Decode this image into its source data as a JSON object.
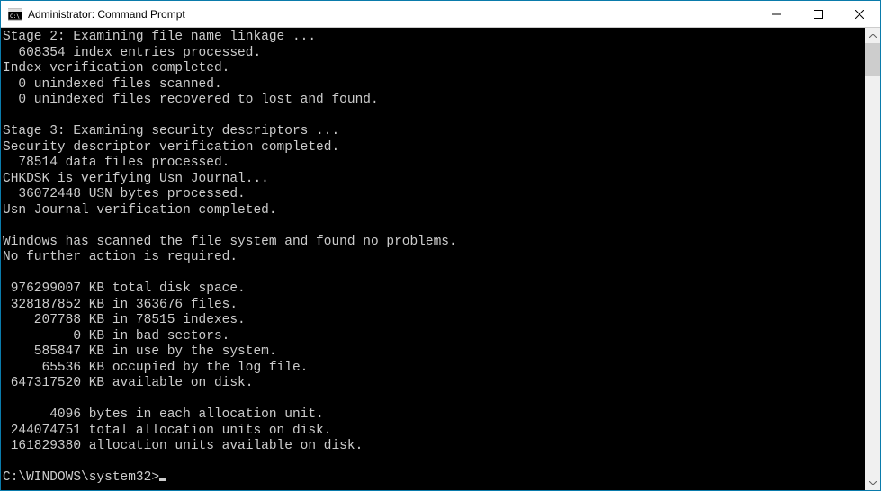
{
  "window": {
    "title": "Administrator: Command Prompt"
  },
  "stage2": {
    "header": "Stage 2: Examining file name linkage ...",
    "entries": "  608354 index entries processed.",
    "verified": "Index verification completed.",
    "unindexed_scanned": "  0 unindexed files scanned.",
    "unindexed_recovered": "  0 unindexed files recovered to lost and found."
  },
  "stage3": {
    "header": "Stage 3: Examining security descriptors ...",
    "verified": "Security descriptor verification completed.",
    "data_files": "  78514 data files processed.",
    "usn_verify": "CHKDSK is verifying Usn Journal...",
    "usn_bytes": "  36072448 USN bytes processed.",
    "usn_done": "Usn Journal verification completed."
  },
  "summary": {
    "no_problems": "Windows has scanned the file system and found no problems.",
    "no_action": "No further action is required."
  },
  "disk": {
    "total": " 976299007 KB total disk space.",
    "in_files": " 328187852 KB in 363676 files.",
    "in_indexes": "    207788 KB in 78515 indexes.",
    "bad_sectors": "         0 KB in bad sectors.",
    "system_use": "    585847 KB in use by the system.",
    "log_file": "     65536 KB occupied by the log file.",
    "available": " 647317520 KB available on disk."
  },
  "alloc": {
    "unit_size": "      4096 bytes in each allocation unit.",
    "total_units": " 244074751 total allocation units on disk.",
    "avail_units": " 161829380 allocation units available on disk."
  },
  "prompt": "C:\\WINDOWS\\system32>"
}
